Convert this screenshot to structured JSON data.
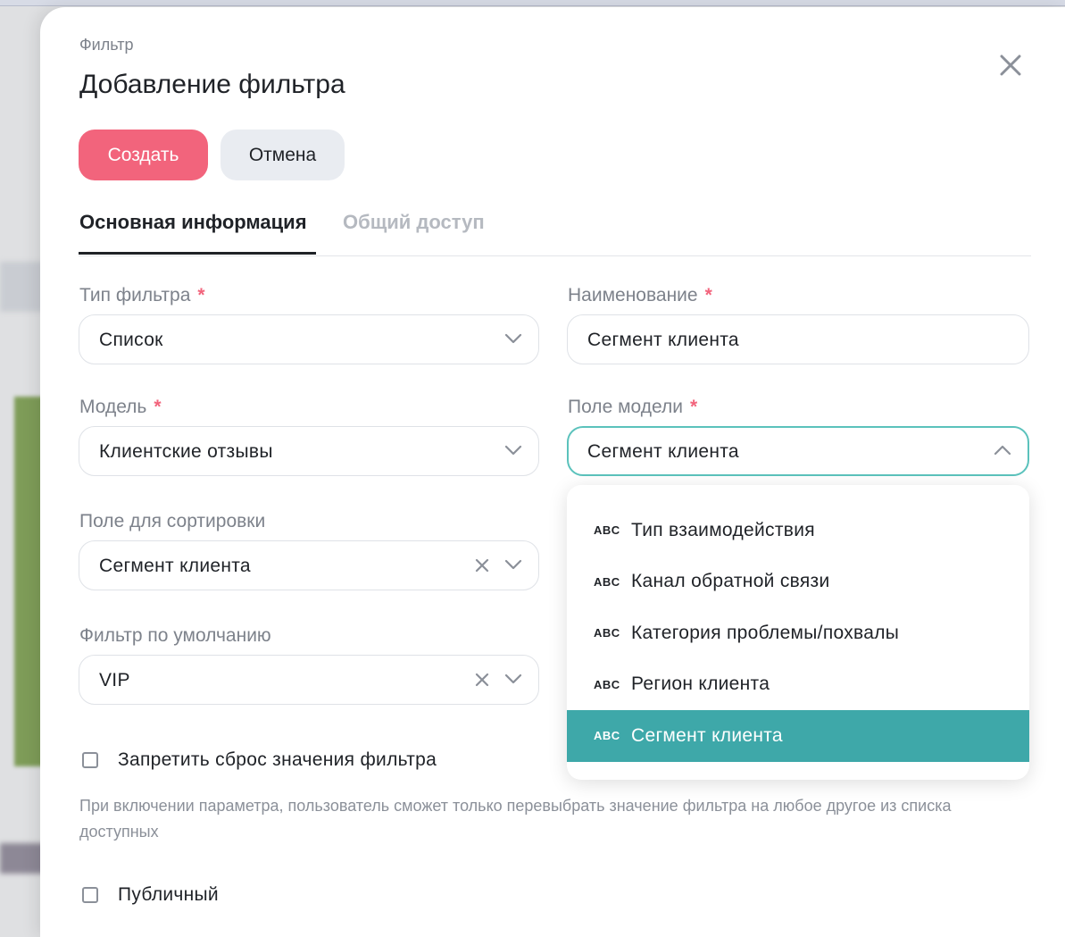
{
  "modal": {
    "eyebrow": "Фильтр",
    "title": "Добавление фильтра",
    "actions": {
      "create": "Создать",
      "cancel": "Отмена"
    },
    "tabs": [
      {
        "label": "Основная информация",
        "active": true
      },
      {
        "label": "Общий доступ",
        "active": false
      }
    ],
    "form": {
      "filter_type": {
        "label": "Тип фильтра",
        "required": "*",
        "value": "Список"
      },
      "name": {
        "label": "Наименование",
        "required": "*",
        "value": "Сегмент клиента"
      },
      "model": {
        "label": "Модель",
        "required": "*",
        "value": "Клиентские отзывы"
      },
      "model_field": {
        "label": "Поле модели",
        "required": "*",
        "value": "Сегмент клиента",
        "open": true
      },
      "sort_field": {
        "label": "Поле для сортировки",
        "value": "Сегмент клиента"
      },
      "default_filter": {
        "label": "Фильтр по умолчанию",
        "value": "VIP"
      },
      "forbid_reset": {
        "label": "Запретить сброс значения фильтра",
        "checked": false
      },
      "hint": "При включении параметра, пользователь сможет только перевыбрать значение фильтра на любое другое из списка доступных",
      "public": {
        "label": "Публичный",
        "checked": false
      }
    },
    "dropdown": {
      "items": [
        {
          "type_tag": "ABC",
          "label": "Тип взаимодействия",
          "selected": false
        },
        {
          "type_tag": "ABC",
          "label": "Канал обратной связи",
          "selected": false
        },
        {
          "type_tag": "ABC",
          "label": "Категория проблемы/похвалы",
          "selected": false
        },
        {
          "type_tag": "ABC",
          "label": "Регион клиента",
          "selected": false
        },
        {
          "type_tag": "ABC",
          "label": "Сегмент клиента",
          "selected": true
        }
      ]
    }
  },
  "icons": {
    "close": "close-icon",
    "chevron_down": "chevron-down-icon",
    "chevron_up": "chevron-up-icon",
    "clear": "clear-icon"
  },
  "colors": {
    "primary": "#f2647c",
    "accent_teal": "#3ea8a9",
    "focus_border": "#5bc2bc",
    "required": "#f2647c"
  }
}
